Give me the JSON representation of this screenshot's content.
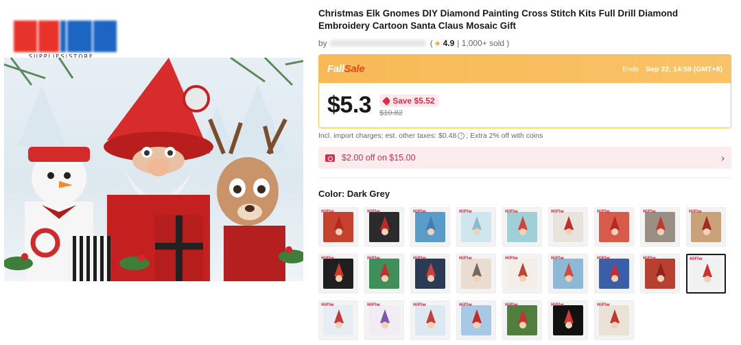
{
  "store": {
    "caption": "SUPPLIES|STORE",
    "logo_colors": [
      "#e8332b",
      "#e8332b",
      "#1c66c2",
      "#1c66c2",
      "#1c66c2"
    ]
  },
  "product": {
    "title": "Christmas Elk Gnomes DIY Diamond Painting Cross Stitch Kits Full Drill Diamond Embroidery Cartoon Santa Claus Mosaic Gift",
    "by_prefix": "by",
    "rating": "4.9",
    "sold": "| 1,000+ sold )",
    "rating_open": "("
  },
  "sale": {
    "logo_part1": "Fall",
    "logo_part2": "Sale",
    "ends_label": "Ends",
    "ends_date": "Sep 22, 14:59 (GMT+8)",
    "price": "$5.3",
    "save": "Save $5.52",
    "original_price": "$10.82",
    "accent_color": "#f7b955"
  },
  "tax": {
    "text": "Incl. import charges; est. other taxes: $0.48",
    "extra": "; Extra 2% off with coins"
  },
  "coupon": {
    "text": "$2.00 off on $15.00"
  },
  "color": {
    "label": "Color:",
    "selected": "Dark Grey",
    "brand_mark": "HiFlw",
    "swatches": [
      {
        "bg": "#c7412f",
        "hat": "#b9261f"
      },
      {
        "bg": "#2b2b2b",
        "hat": "#c0282b"
      },
      {
        "bg": "#5a9cc9",
        "hat": "#3f7fb4"
      },
      {
        "bg": "#cfe6ef",
        "hat": "#8fb9d0"
      },
      {
        "bg": "#9fd0d8",
        "hat": "#d4443a"
      },
      {
        "bg": "#e8e3dc",
        "hat": "#c42d2d"
      },
      {
        "bg": "#d85a4a",
        "hat": "#b72a24"
      },
      {
        "bg": "#9a8f84",
        "hat": "#c0392b"
      },
      {
        "bg": "#c9a27a",
        "hat": "#a32a22"
      },
      {
        "bg": "#1f1f1f",
        "hat": "#d23a2e"
      },
      {
        "bg": "#3f8f5a",
        "hat": "#c62e2e"
      },
      {
        "bg": "#2b3a55",
        "hat": "#d1403a"
      },
      {
        "bg": "#e8ddd0",
        "hat": "#7a6757"
      },
      {
        "bg": "#f3efe8",
        "hat": "#c04530"
      },
      {
        "bg": "#8db8d6",
        "hat": "#d24a3a"
      },
      {
        "bg": "#3a5fa8",
        "hat": "#c73030"
      },
      {
        "bg": "#b8402e",
        "hat": "#8c2420"
      },
      {
        "bg": "#f1f1f1",
        "hat": "#d22f2f"
      },
      {
        "bg": "#e6eef3",
        "hat": "#c23a3a"
      },
      {
        "bg": "#f2ecf5",
        "hat": "#7f55b0"
      },
      {
        "bg": "#dde9f0",
        "hat": "#c83d34"
      },
      {
        "bg": "#a8c9e6",
        "hat": "#c62828"
      },
      {
        "bg": "#4f7e3e",
        "hat": "#c53030"
      },
      {
        "bg": "#111111",
        "hat": "#d33b32"
      },
      {
        "bg": "#e9e2d6",
        "hat": "#bf3b2f"
      }
    ],
    "selected_index": 17
  }
}
